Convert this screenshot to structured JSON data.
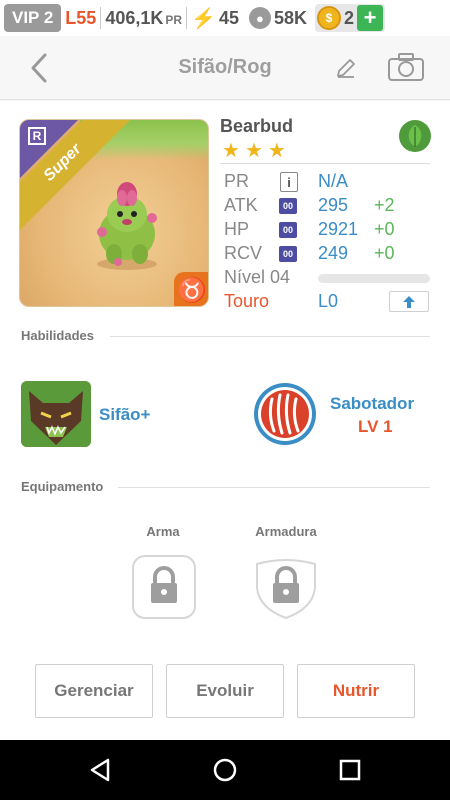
{
  "status_bar": {
    "vip": "VIP 2",
    "level": "L55",
    "pr_amount": "406,1K",
    "pr_unit": "PR",
    "energy": "45",
    "food": "58K",
    "gems": "2",
    "add_label": "+"
  },
  "header": {
    "title": "Sifão/Rog"
  },
  "monster": {
    "name": "Bearbud",
    "rarity_letter": "R",
    "class_label": "Super",
    "zodiac_symbol": "♉",
    "stars": 3,
    "element_icon": "leaf-icon",
    "stats": {
      "pr": {
        "label": "PR",
        "info": "i",
        "value": "N/A"
      },
      "atk": {
        "label": "ATK",
        "icon_text": "00",
        "value": "295",
        "bonus": "+2"
      },
      "hp": {
        "label": "HP",
        "icon_text": "00",
        "value": "2921",
        "bonus": "+0"
      },
      "rcv": {
        "label": "RCV",
        "icon_text": "00",
        "value": "249",
        "bonus": "+0"
      }
    },
    "level_label": "Nível 04",
    "xp_fraction": 0.0,
    "zodiac_name": "Touro",
    "league": "L0"
  },
  "sections": {
    "skills": "Habilidades",
    "equipment": "Equipamento"
  },
  "skill": {
    "name": "Sifão+"
  },
  "trait": {
    "name": "Sabotador",
    "level": "LV 1"
  },
  "equipment": {
    "weapon": "Arma",
    "armor": "Armadura"
  },
  "actions": {
    "manage": "Gerenciar",
    "evolve": "Evoluir",
    "feed": "Nutrir"
  },
  "colors": {
    "accent_blue": "#3a8dc5",
    "accent_orange": "#e8562b",
    "accent_green": "#5cb85c",
    "star": "#f1b51c"
  }
}
